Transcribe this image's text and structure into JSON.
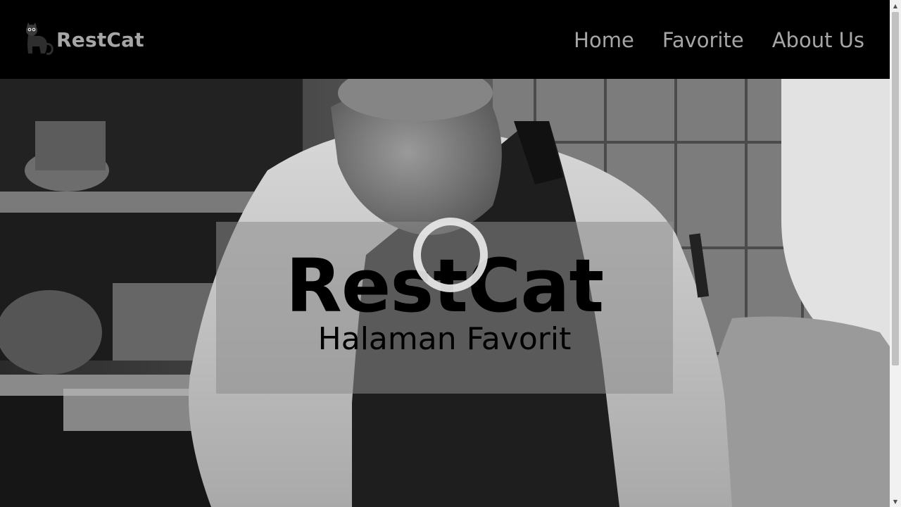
{
  "header": {
    "brand_name": "RestCat",
    "logo_icon": "cat-logo-icon",
    "nav": [
      {
        "label": "Home"
      },
      {
        "label": "Favorite"
      },
      {
        "label": "About Us"
      }
    ]
  },
  "hero": {
    "title": "RestCat",
    "subtitle": "Halaman Favorit",
    "background": "chef-photo-grayscale"
  },
  "colors": {
    "header_bg": "#000000",
    "header_text": "#a6a6a6",
    "panel_overlay": "#8c8c8c",
    "hero_text": "#000000"
  }
}
